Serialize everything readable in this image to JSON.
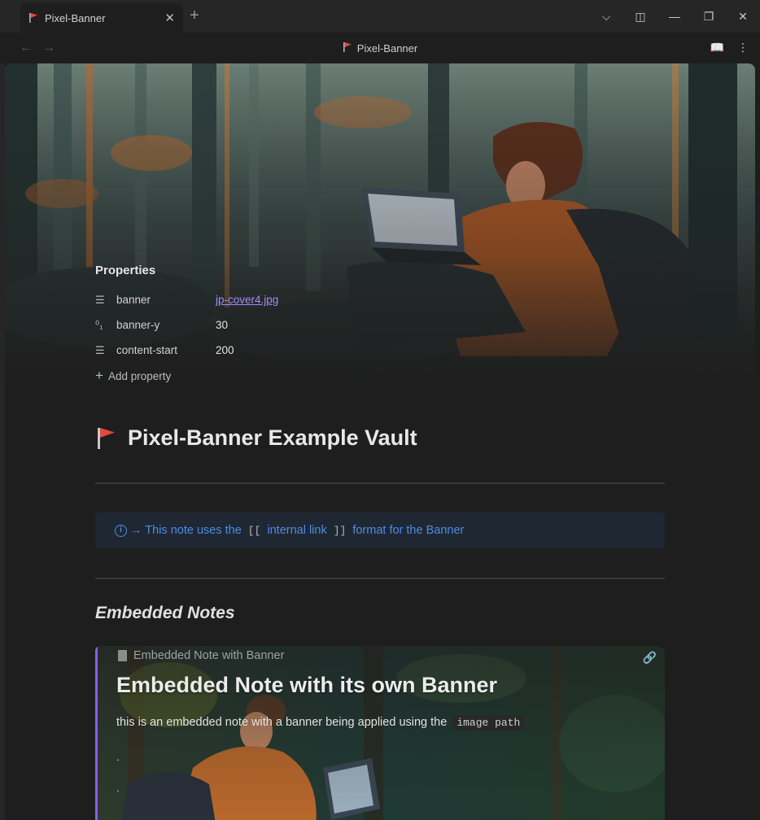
{
  "tab": {
    "label": "Pixel-Banner",
    "close_label": "✕",
    "new_tab_label": "+"
  },
  "window": {
    "dropdown": "⌵",
    "sidebar_toggle": "◫",
    "minimize": "—",
    "restore": "❐",
    "close": "✕"
  },
  "nav": {
    "back": "←",
    "forward": "→",
    "title": "Pixel-Banner",
    "reading_icon": "📖",
    "more_icon": "⋮"
  },
  "properties": {
    "heading": "Properties",
    "rows": [
      {
        "icon": "☰",
        "key": "banner",
        "value": "jp-cover4.jpg",
        "is_link": true
      },
      {
        "icon": "⁰₁",
        "key": "banner-y",
        "value": "30",
        "is_link": false
      },
      {
        "icon": "☰",
        "key": "content-start",
        "value": "200",
        "is_link": false
      }
    ],
    "add_label": "Add property",
    "add_icon": "+"
  },
  "document": {
    "title": "Pixel-Banner Example Vault",
    "callout": {
      "info_icon": "i",
      "prefix": "→ This note uses the",
      "code_open": "[[",
      "link_text": "internal link",
      "code_close": "]]",
      "suffix": "format for the Banner"
    },
    "section_heading": "Embedded Notes"
  },
  "embed": {
    "header": "Embedded Note with Banner",
    "link_icon": "🔗",
    "title": "Embedded Note with its own Banner",
    "text": "this is an embedded note with a banner being applied using the",
    "code": "image path",
    "dots": [
      ".",
      "."
    ]
  },
  "colors": {
    "accent": "#8a5cf5",
    "link": "#a68af9",
    "callout_text": "#4d8de3",
    "flag": "#e5483f"
  }
}
